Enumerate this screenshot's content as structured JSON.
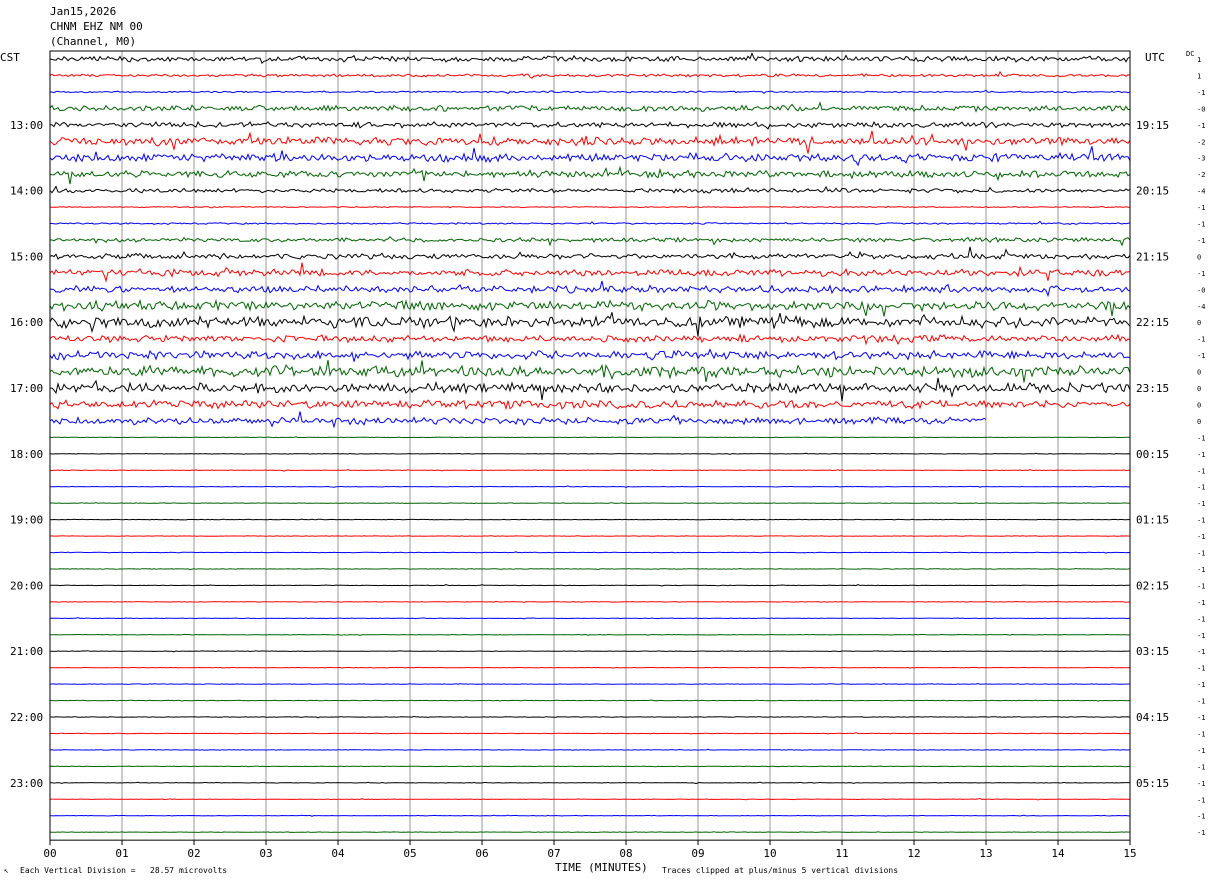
{
  "header": {
    "date": "Jan15,2026",
    "station": "CHNM EHZ NM 00",
    "channel": "(Channel, M0)"
  },
  "left_tz": "CST",
  "right_tz": "UTC",
  "dc_label": "DC",
  "footer": {
    "marker": "↖",
    "division": "Each Vertical Division =   28.57 microvolts",
    "xaxis_title": "TIME (MINUTES)",
    "clip_note": "Traces clipped at plus/minus 5 vertical divisions"
  },
  "chart_data": {
    "type": "helicorder",
    "title": "CHNM EHZ NM 00",
    "xlabel": "TIME (MINUTES)",
    "xlim": [
      0,
      15
    ],
    "x_ticks": [
      "00",
      "01",
      "02",
      "03",
      "04",
      "05",
      "06",
      "07",
      "08",
      "09",
      "10",
      "11",
      "12",
      "13",
      "14",
      "15"
    ],
    "trace_colors": [
      "#000000",
      "#ff0000",
      "#0000ff",
      "#006400"
    ],
    "left_hour_labels": [
      "13:00",
      "14:00",
      "15:00",
      "16:00",
      "17:00",
      "18:00",
      "19:00",
      "20:00",
      "21:00",
      "22:00",
      "23:00"
    ],
    "right_hour_labels": [
      "19:15",
      "20:15",
      "21:15",
      "22:15",
      "23:15",
      "00:15",
      "01:15",
      "02:15",
      "03:15",
      "04:15",
      "05:15"
    ],
    "first_labeled_row": 4,
    "row_dc_offsets": [
      "1",
      "1",
      "-1",
      "-0",
      "-1",
      "-2",
      "-3",
      "-2",
      "-4",
      "-1",
      "-1",
      "-1",
      "0",
      "-1",
      "-0",
      "-4",
      "0",
      "-1",
      "-1",
      "0",
      "0",
      "0",
      "0",
      "-1",
      "-1",
      "-1",
      "-1",
      "-1",
      "-1",
      "-1",
      "-1",
      "-1",
      "-1",
      "-1",
      "-1",
      "-1",
      "-1",
      "-1",
      "-1",
      "-1",
      "-1",
      "-1",
      "-1",
      "-1",
      "-1",
      "-1",
      "-1",
      "-1"
    ],
    "row_activity": [
      2,
      1,
      0.6,
      2,
      2,
      3,
      3,
      2.5,
      1.5,
      0.4,
      0.6,
      1.5,
      2,
      2.5,
      2.5,
      3.5,
      4,
      2.5,
      3,
      4,
      3.5,
      3,
      2.5,
      0.2,
      0.2,
      0.2,
      0.2,
      0.2,
      0.2,
      0.2,
      0.2,
      0.2,
      0.2,
      0.2,
      0.2,
      0.2,
      0.2,
      0.2,
      0.2,
      0.2,
      0.2,
      0.2,
      0.2,
      0.2,
      0.2,
      0.2,
      0.2,
      0.2
    ],
    "last_partial_trace": {
      "row": 22,
      "end_minute": 13.0
    },
    "vertical_division_microvolts": 28.57,
    "clip_divisions": 5
  }
}
